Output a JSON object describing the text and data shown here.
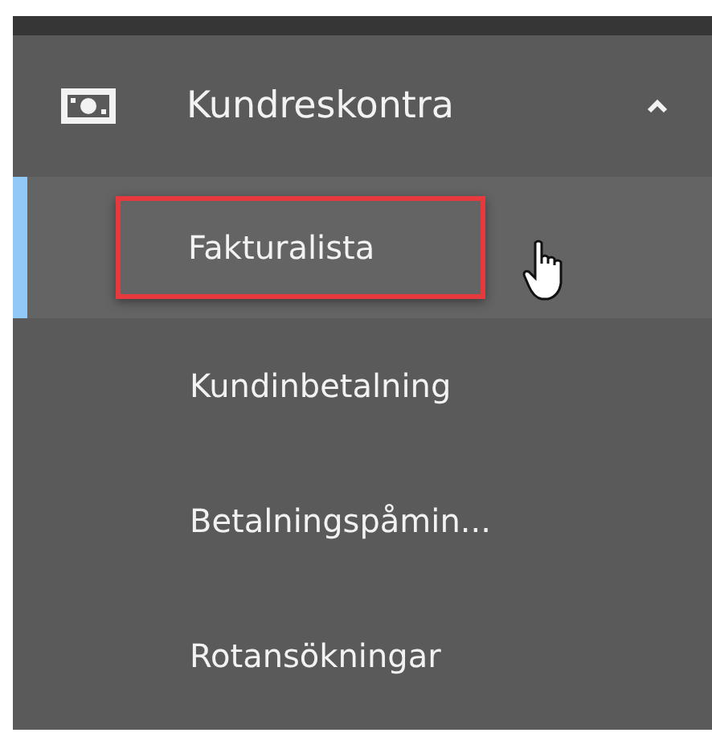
{
  "section": {
    "label": "Kundreskontra",
    "expanded": true
  },
  "items": [
    {
      "label": "Fakturalista",
      "selected": true,
      "highlighted": true
    },
    {
      "label": "Kundinbetalning",
      "selected": false,
      "highlighted": false
    },
    {
      "label": "Betalningspåmin...",
      "selected": false,
      "highlighted": false
    },
    {
      "label": "Rotansökningar",
      "selected": false,
      "highlighted": false
    }
  ]
}
